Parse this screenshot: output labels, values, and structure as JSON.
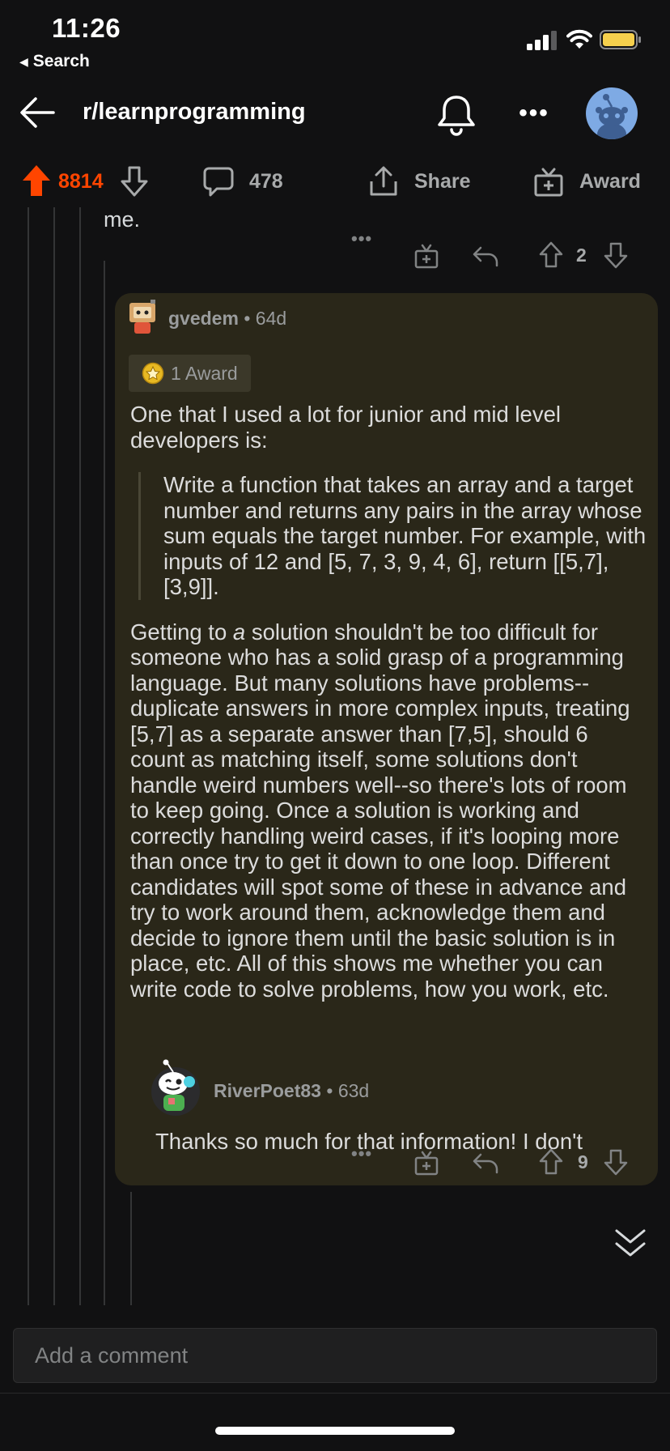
{
  "status": {
    "time": "11:26",
    "back_app": "Search"
  },
  "header": {
    "title": "r/learnprogramming"
  },
  "post_bar": {
    "score": "8814",
    "comments": "478",
    "share": "Share",
    "award": "Award"
  },
  "prev_comment": {
    "text_tail": "me.",
    "vote_count": "2"
  },
  "comment": {
    "username": "gvedem",
    "separator": "•",
    "age": "64d",
    "award_label": "1 Award",
    "intro": "One that I used a lot for junior and mid level developers is:",
    "quote": "Write a function that takes an array and a target number and returns any pairs in the array whose sum equals the target number. For example, with inputs of 12 and [5, 7, 3, 9, 4, 6], return [[5,7], [3,9]].",
    "body_lead": "Getting to ",
    "body_em": "a",
    "body_rest": " solution shouldn't be too difficult for someone who has a solid grasp of a programming language. But many solutions have problems--duplicate answers in more complex inputs, treating [5,7] as a separate answer than [7,5], should 6 count as matching itself, some solutions don't handle weird numbers well--so there's lots of room to keep going. Once a solution is working and correctly handling weird cases, if it's looping more than once try to get it down to one loop. Different candidates will spot some of these in advance and try to work around them, acknowledge them and decide to ignore them until the basic solution is in place, etc. All of this shows me whether you can write code to solve problems, how you work, etc.",
    "vote_count": "9"
  },
  "reply": {
    "username": "RiverPoet83",
    "separator": "•",
    "age": "63d",
    "text": "Thanks so much for that information! I don't"
  },
  "comment_box": {
    "placeholder": "Add a comment"
  },
  "colors": {
    "upvote": "#ff4500",
    "background": "#111112",
    "card": "#2a2719",
    "avatar_blue": "#7eaae4"
  }
}
